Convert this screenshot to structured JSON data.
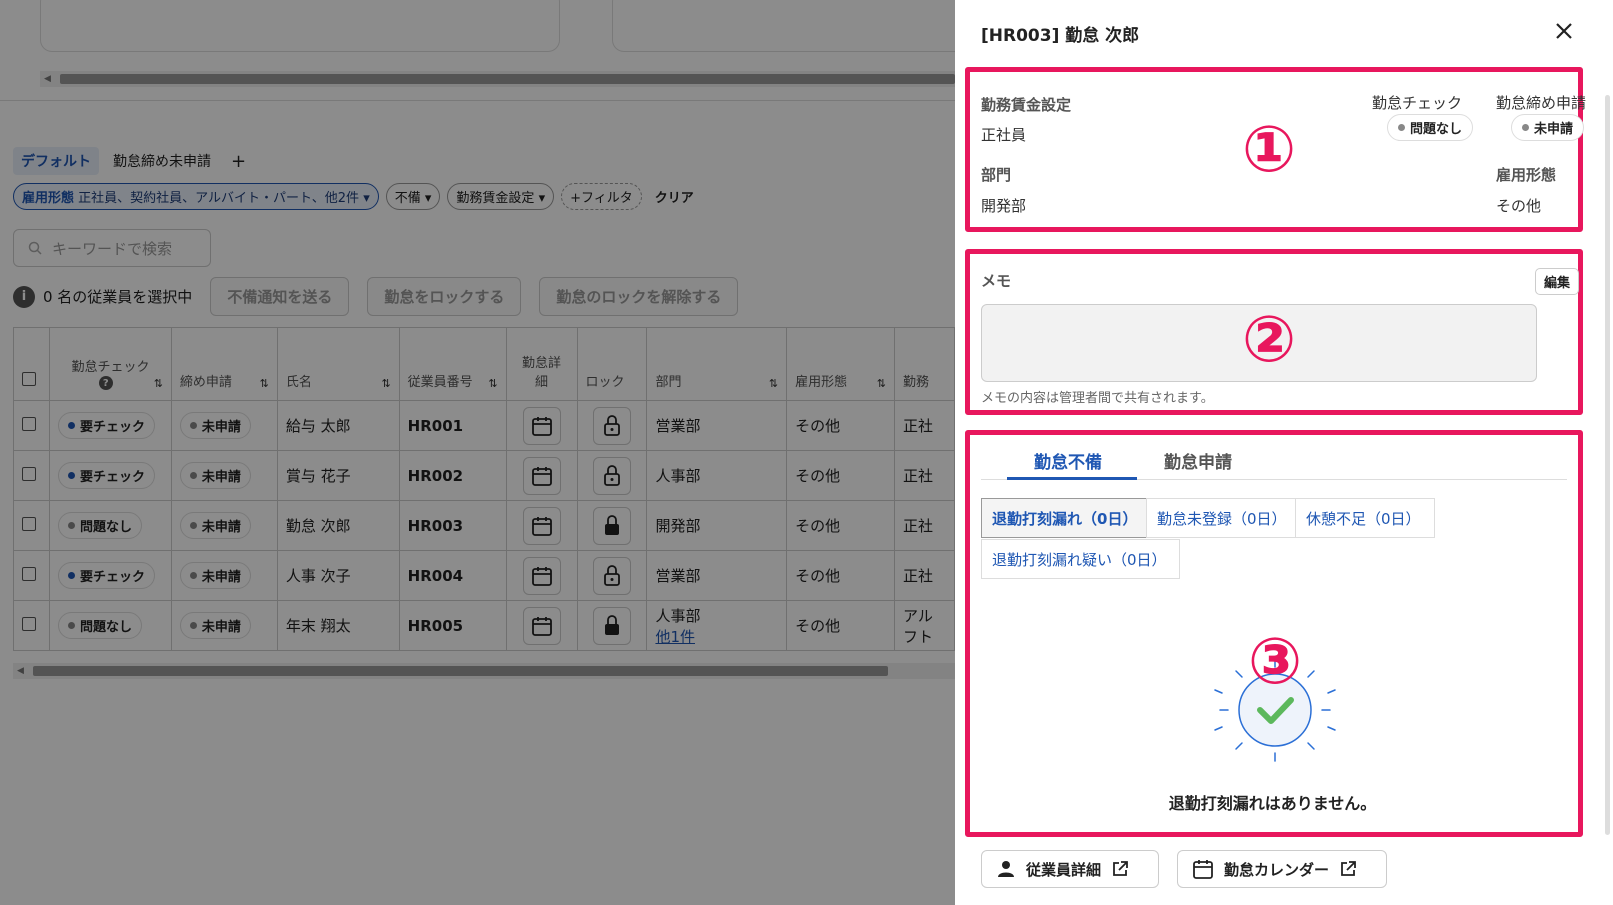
{
  "views": {
    "tabs": [
      "デフォルト",
      "勤怠締め未申請"
    ],
    "add": "+"
  },
  "filters": {
    "employment_label": "雇用形態",
    "employment_value": "正社員、契約社員、アルバイト・パート、他2件",
    "missing": "不備",
    "wage": "勤務賃金設定",
    "add_filter": "+フィルタ",
    "clear": "クリア"
  },
  "search": {
    "placeholder": "キーワードで検索"
  },
  "selection": {
    "info": "i",
    "text": "0 名の従業員を選択中",
    "btn_notify": "不備通知を送る",
    "btn_lock": "勤怠をロックする",
    "btn_unlock": "勤怠のロックを解除する"
  },
  "table": {
    "columns": {
      "check": "勤怠チェック",
      "check_help": "?",
      "submit": "締め申請",
      "name": "氏名",
      "number": "従業員番号",
      "detail_1": "勤怠詳",
      "detail_2": "細",
      "lock": "ロック",
      "dept": "部門",
      "type": "雇用形態",
      "wage": "勤務"
    },
    "rows": [
      {
        "check": "要チェック",
        "submit": "未申請",
        "name": "給与 太郎",
        "number": "HR001",
        "dept": "営業部",
        "dept2": "",
        "type": "その他",
        "wage": "正社",
        "wage2": ""
      },
      {
        "check": "要チェック",
        "submit": "未申請",
        "name": "賞与 花子",
        "number": "HR002",
        "dept": "人事部",
        "dept2": "",
        "type": "その他",
        "wage": "正社",
        "wage2": ""
      },
      {
        "check": "問題なし",
        "submit": "未申請",
        "name": "勤怠 次郎",
        "number": "HR003",
        "dept": "開発部",
        "dept2": "",
        "type": "その他",
        "wage": "正社",
        "wage2": ""
      },
      {
        "check": "要チェック",
        "submit": "未申請",
        "name": "人事 次子",
        "number": "HR004",
        "dept": "営業部",
        "dept2": "",
        "type": "その他",
        "wage": "正社",
        "wage2": ""
      },
      {
        "check": "問題なし",
        "submit": "未申請",
        "name": "年末 翔太",
        "number": "HR005",
        "dept": "人事部",
        "dept2": "他1件",
        "type": "その他",
        "wage": "アル",
        "wage2": "フト"
      }
    ]
  },
  "panel": {
    "title": "[HR003] 勤怠 次郎",
    "close": "×",
    "section1": {
      "wage_label": "勤務賃金設定",
      "wage_value": "正社員",
      "check_label": "勤怠チェック",
      "check_value": "問題なし",
      "submit_label": "勤怠締め申請",
      "submit_value": "未申請",
      "dept_label": "部門",
      "dept_value": "開発部",
      "type_label": "雇用形態",
      "type_value": "その他"
    },
    "memo": {
      "label": "メモ",
      "edit": "編集",
      "hint": "メモの内容は管理者間で共有されます。"
    },
    "tabs": [
      "勤怠不備",
      "勤怠申請"
    ],
    "segments": [
      "退勤打刻漏れ（0日）",
      "勤怠未登録（0日）",
      "休憩不足（0日）",
      "退勤打刻漏れ疑い（0日）"
    ],
    "empty_message": "退勤打刻漏れはありません。",
    "footer": {
      "employee_detail": "従業員詳細",
      "calendar": "勤怠カレンダー"
    },
    "markers": [
      "①",
      "②",
      "③"
    ]
  },
  "colors": {
    "accent": "#1f57b3",
    "highlight": "#e8175d",
    "overlay": "rgba(0,0,0,0.45)"
  }
}
